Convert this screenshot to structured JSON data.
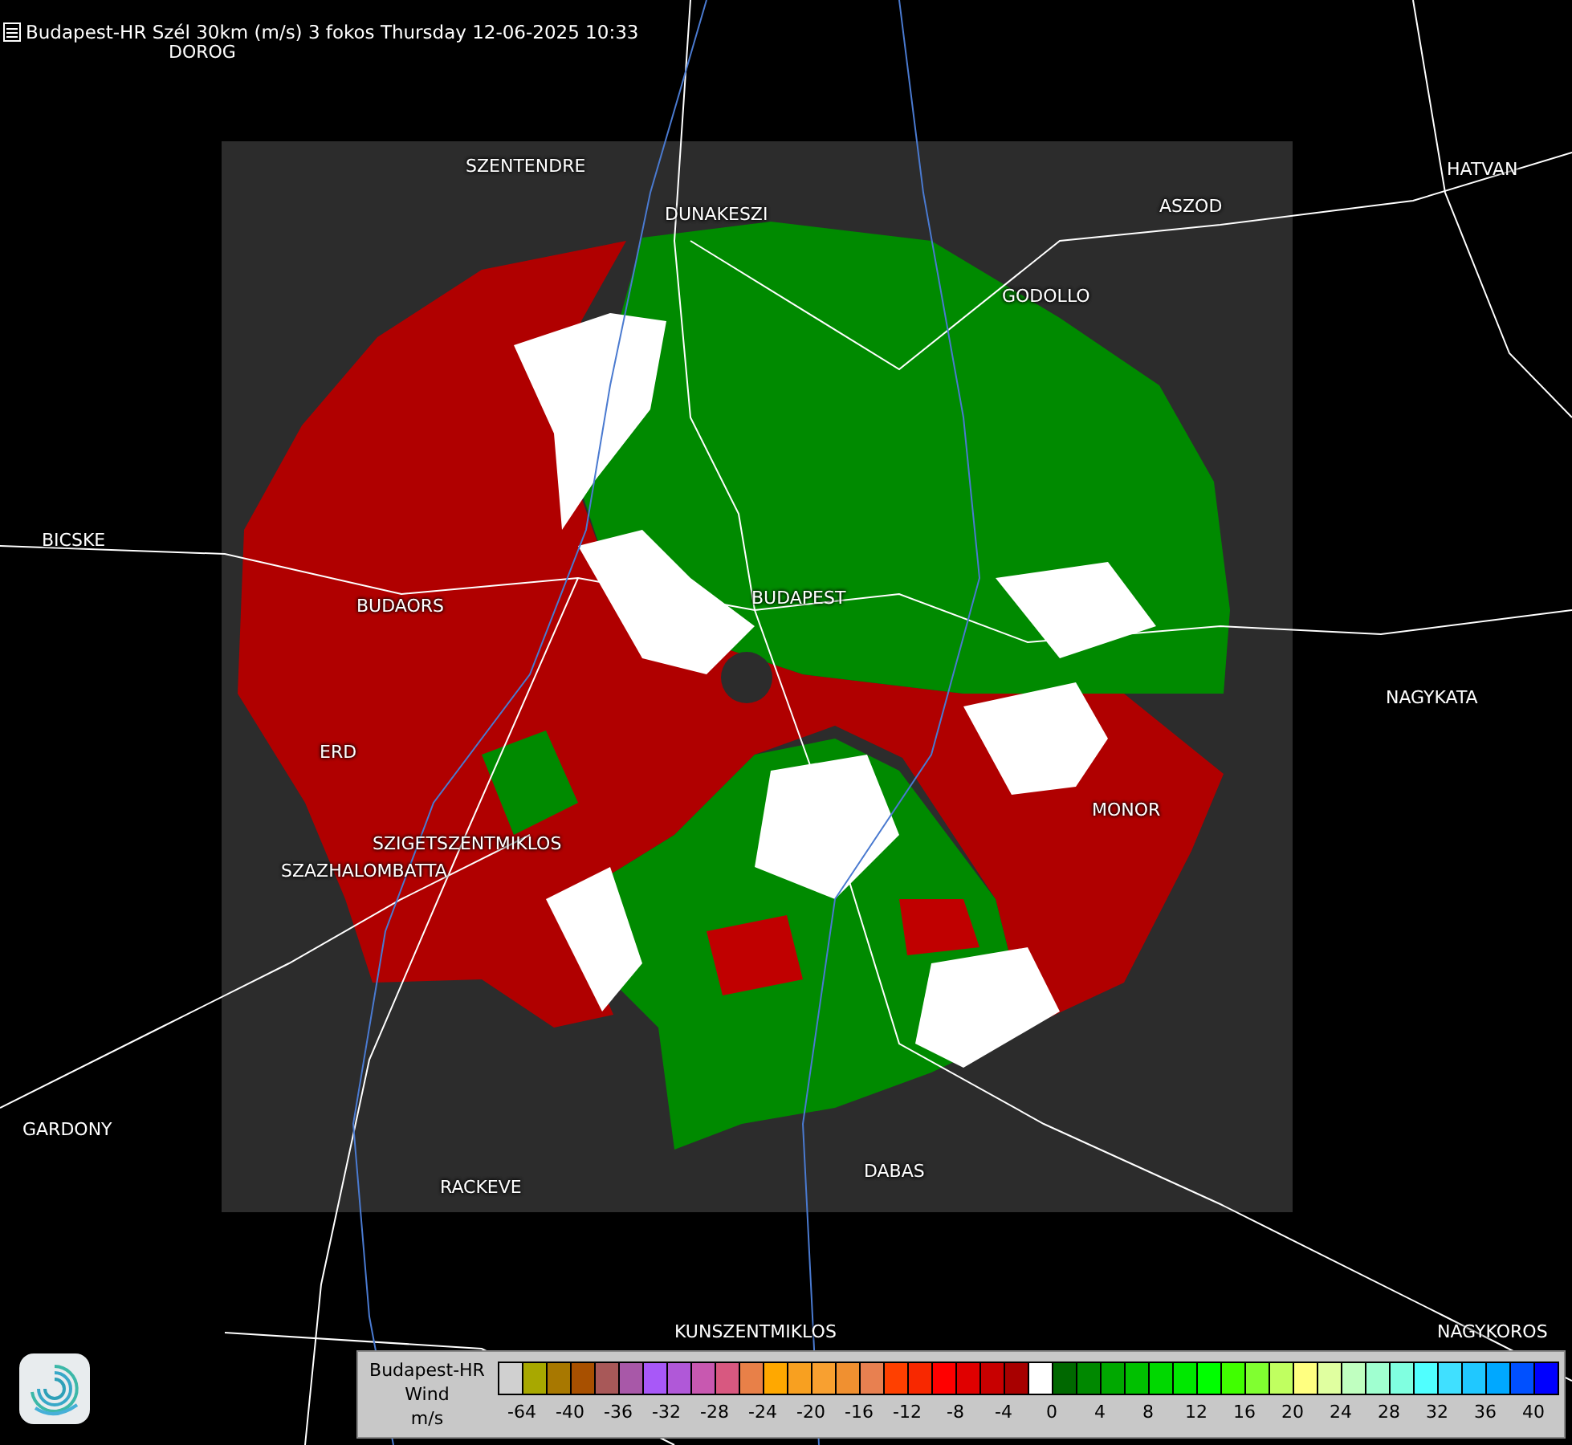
{
  "title": "Budapest-HR Szél 30km (m/s) 3 fokos Thursday 12-06-2025 10:33",
  "map": {
    "places": [
      {
        "name": "DOROG"
      },
      {
        "name": "SZENTENDRE"
      },
      {
        "name": "DUNAKESZI"
      },
      {
        "name": "ASZOD"
      },
      {
        "name": "HATVAN"
      },
      {
        "name": "GODOLLO"
      },
      {
        "name": "BICSKE"
      },
      {
        "name": "BUDAORS"
      },
      {
        "name": "BUDAPEST"
      },
      {
        "name": "NAGYKATA"
      },
      {
        "name": "ERD"
      },
      {
        "name": "SZIGETSZENTMIKLOS"
      },
      {
        "name": "SZAZHALOMBATTA"
      },
      {
        "name": "MONOR"
      },
      {
        "name": "GARDONY"
      },
      {
        "name": "RACKEVE"
      },
      {
        "name": "DABAS"
      },
      {
        "name": "KUNSZENTMIKLOS"
      },
      {
        "name": "NAGYKOROS"
      }
    ]
  },
  "legend": {
    "station": "Budapest-HR",
    "quantity": "Wind",
    "unit": "m/s",
    "swatches": [
      {
        "color": "#d0d0d0"
      },
      {
        "color": "#a8a800"
      },
      {
        "color": "#a87800"
      },
      {
        "color": "#a85000"
      },
      {
        "color": "#a85858"
      },
      {
        "color": "#a858a8"
      },
      {
        "color": "#a858f8"
      },
      {
        "color": "#b058d8"
      },
      {
        "color": "#c858b0"
      },
      {
        "color": "#d85880"
      },
      {
        "color": "#e88048"
      },
      {
        "color": "#ffa800"
      },
      {
        "color": "#f8a020"
      },
      {
        "color": "#f8a030"
      },
      {
        "color": "#f09030"
      },
      {
        "color": "#e88050"
      },
      {
        "color": "#ff4000"
      },
      {
        "color": "#f82800"
      },
      {
        "color": "#ff0000"
      },
      {
        "color": "#e00000"
      },
      {
        "color": "#c80000"
      },
      {
        "color": "#a80000"
      },
      {
        "color": "#ffffff"
      },
      {
        "color": "#006800"
      },
      {
        "color": "#008800"
      },
      {
        "color": "#00a800"
      },
      {
        "color": "#00c000"
      },
      {
        "color": "#00d800"
      },
      {
        "color": "#00e800"
      },
      {
        "color": "#00ff00"
      },
      {
        "color": "#40ff00"
      },
      {
        "color": "#80ff30"
      },
      {
        "color": "#c0ff60"
      },
      {
        "color": "#ffff80"
      },
      {
        "color": "#e0ffa0"
      },
      {
        "color": "#c0ffc0"
      },
      {
        "color": "#a0ffd0"
      },
      {
        "color": "#80ffe0"
      },
      {
        "color": "#50ffff"
      },
      {
        "color": "#40e0ff"
      },
      {
        "color": "#20c8ff"
      },
      {
        "color": "#00a8ff"
      },
      {
        "color": "#0050ff"
      },
      {
        "color": "#0000ff"
      }
    ],
    "ticks": [
      "-64",
      "-40",
      "-36",
      "-32",
      "-28",
      "-24",
      "-20",
      "-16",
      "-12",
      "-8",
      "-4",
      "0",
      "4",
      "8",
      "12",
      "16",
      "20",
      "24",
      "28",
      "32",
      "36",
      "40"
    ]
  }
}
